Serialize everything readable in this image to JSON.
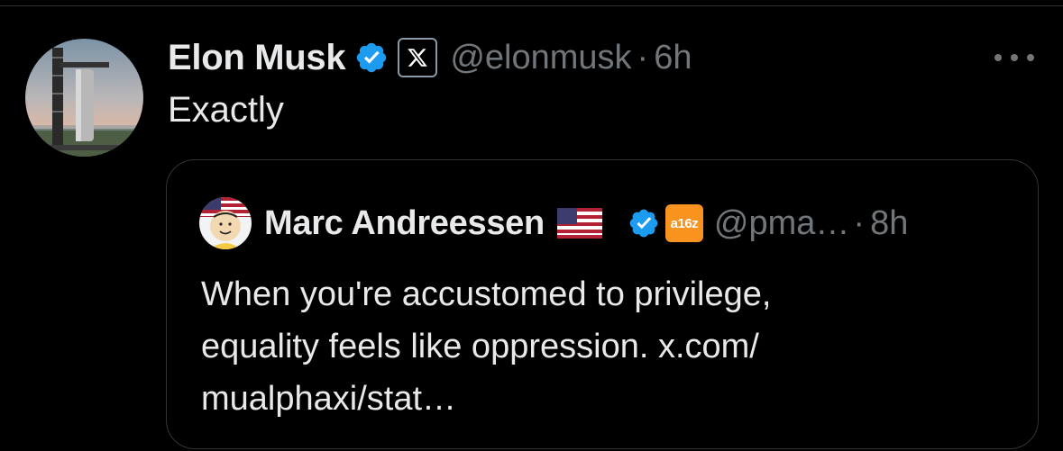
{
  "post": {
    "author_name": "Elon Musk",
    "handle": "@elonmusk",
    "separator": "·",
    "time": "6h",
    "affiliation_icon": "x-logo-icon",
    "text": "Exactly"
  },
  "quote": {
    "author_name": "Marc Andreessen",
    "flag_icon": "us-flag-icon",
    "affiliation_label": "a16z",
    "handle": "@pma…",
    "separator": "·",
    "time": "8h",
    "text_line1": "When you're accustomed to privilege,",
    "text_line2": "equality feels like oppression. x.com/",
    "text_line3": "mualphaxi/stat…"
  },
  "colors": {
    "background": "#000000",
    "primary_text": "#e7e9ea",
    "secondary_text": "#71767b",
    "verified_blue": "#1d9bf0",
    "border": "#2f3336",
    "a16z_orange": "#f7931e"
  }
}
